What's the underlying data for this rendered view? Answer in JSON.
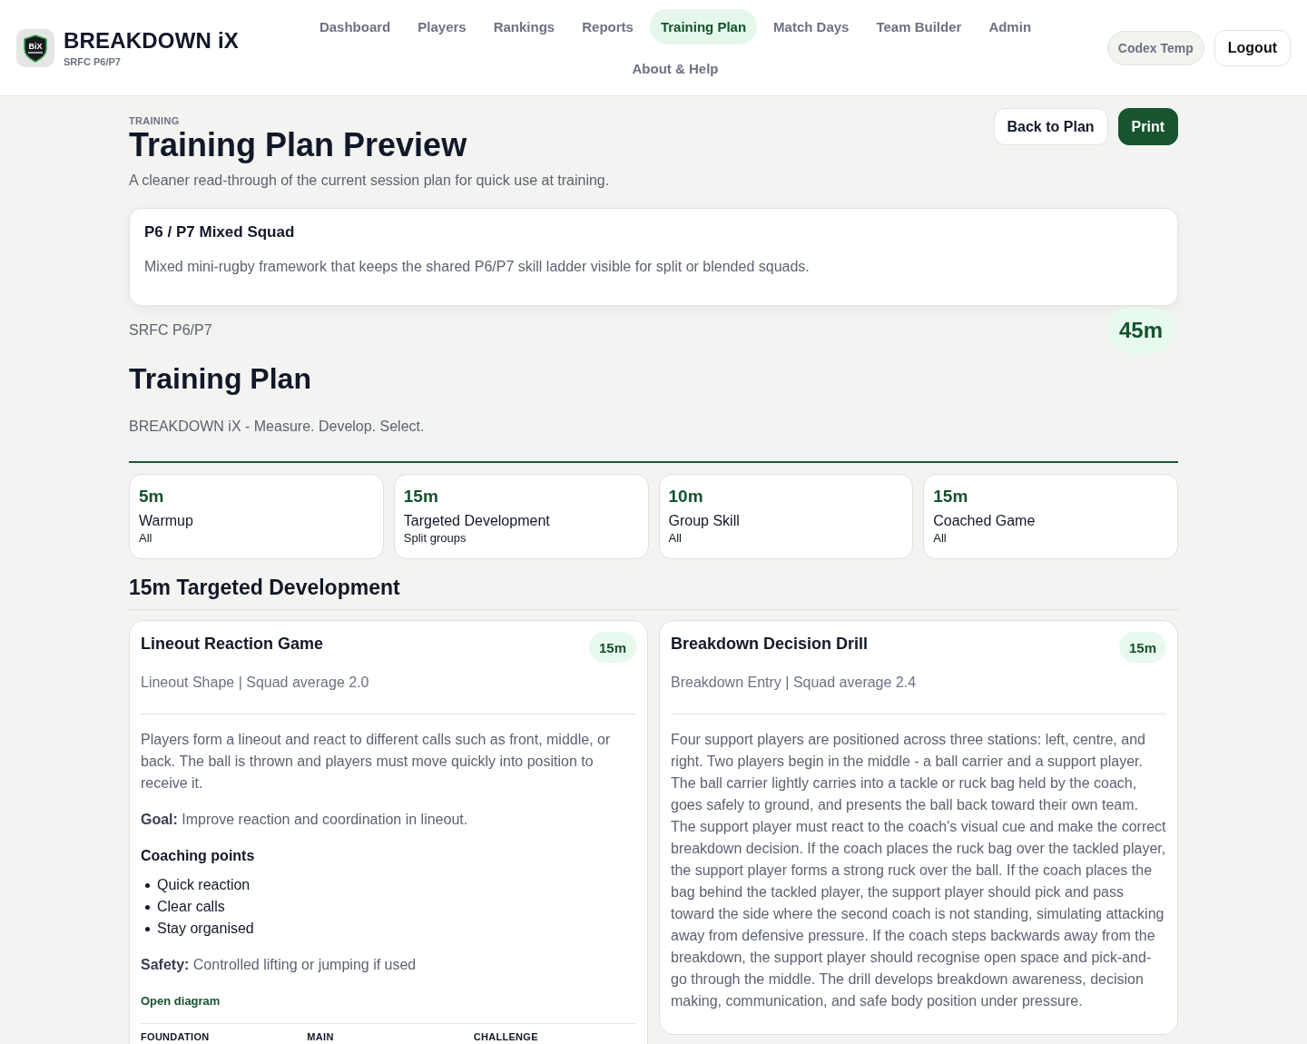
{
  "brand": {
    "logo_text": "BiX",
    "name": "BREAKDOWN iX",
    "subtitle": "SRFC P6/P7"
  },
  "nav": [
    {
      "label": "Dashboard",
      "selected": false
    },
    {
      "label": "Players",
      "selected": false
    },
    {
      "label": "Rankings",
      "selected": false
    },
    {
      "label": "Reports",
      "selected": false
    },
    {
      "label": "Training Plan",
      "selected": true
    },
    {
      "label": "Match Days",
      "selected": false
    },
    {
      "label": "Team Builder",
      "selected": false
    },
    {
      "label": "Admin",
      "selected": false
    },
    {
      "label": "About & Help",
      "selected": false
    }
  ],
  "user": {
    "name": "Codex Temp",
    "action": "Logout"
  },
  "page": {
    "eyebrow": "TRAINING",
    "title": "Training Plan Preview",
    "subtitle": "A cleaner read-through of the current session plan for quick use at training.",
    "actions": [
      {
        "label": "Back to Plan",
        "kind": "secondary"
      },
      {
        "label": "Print",
        "kind": "primary"
      }
    ]
  },
  "squad": {
    "title": "P6 / P7 Mixed Squad",
    "description": "Mixed mini-rugby framework that keeps the shared P6/P7 skill ladder visible for split or blended squads."
  },
  "plan": {
    "team": "SRFC P6/P7",
    "total": "45m",
    "title": "Training Plan",
    "tagline": "BREAKDOWN iX - Measure. Develop. Select."
  },
  "blocks": [
    {
      "duration": "5m",
      "name": "Warmup",
      "group": "All"
    },
    {
      "duration": "15m",
      "name": "Targeted Development",
      "group": "Split groups"
    },
    {
      "duration": "10m",
      "name": "Group Skill",
      "group": "All"
    },
    {
      "duration": "15m",
      "name": "Coached Game",
      "group": "All"
    }
  ],
  "section": {
    "title": "15m Targeted Development",
    "drills": [
      {
        "title": "Lineout Reaction Game",
        "duration": "15m",
        "meta": "Lineout Shape | Squad average 2.0",
        "description": "Players form a lineout and react to different calls such as front, middle, or back. The ball is thrown and players must move quickly into position to receive it.",
        "goal": "**Goal:** Improve reaction and coordination in lineout.",
        "coaching_title": "Coaching points",
        "coaching_points": [
          "Quick reaction",
          "Clear calls",
          "Stay organised"
        ],
        "safety": "**Safety:** Controlled lifting or jumping if used",
        "diagram_link": "Open diagram",
        "tiers": [
          "FOUNDATION",
          "MAIN",
          "CHALLENGE"
        ]
      },
      {
        "title": "Breakdown Decision Drill",
        "duration": "15m",
        "meta": "Breakdown Entry | Squad average 2.4",
        "description": "Four support players are positioned across three stations: left, centre, and right. Two players begin in the middle - a ball carrier and a support player. The ball carrier lightly carries into a tackle or ruck bag held by the coach, goes safely to ground, and presents the ball back toward their own team. The support player must react to the coach's visual cue and make the correct breakdown decision. If the coach places the ruck bag over the tackled player, the support player forms a strong ruck over the ball. If the coach places the bag behind the tackled player, the support player should pick and pass toward the side where the second coach is not standing, simulating attacking away from defensive pressure. If the coach steps backwards away from the breakdown, the support player should recognise open space and pick-and-go through the middle. The drill develops breakdown awareness, decision making, communication, and safe body position under pressure."
      }
    ]
  }
}
